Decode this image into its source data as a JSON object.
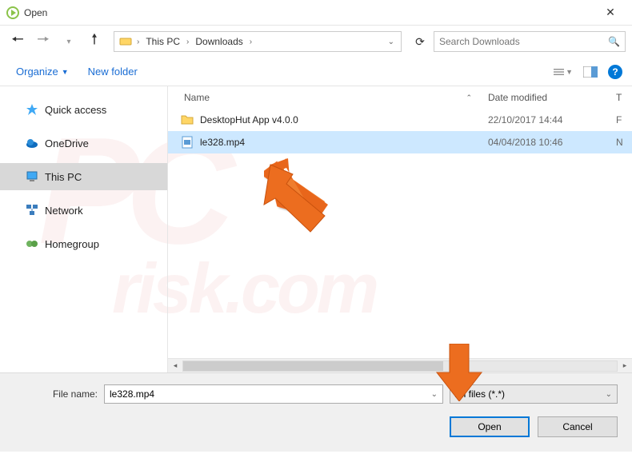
{
  "window": {
    "title": "Open",
    "close": "✕"
  },
  "nav": {
    "path": [
      "This PC",
      "Downloads"
    ],
    "search_placeholder": "Search Downloads"
  },
  "toolbar": {
    "organize": "Organize",
    "new_folder": "New folder",
    "help": "?"
  },
  "sidebar": {
    "items": [
      {
        "label": "Quick access",
        "icon": "star",
        "color": "#3fa9f5"
      },
      {
        "label": "OneDrive",
        "icon": "cloud",
        "color": "#0f6cbd"
      },
      {
        "label": "This PC",
        "icon": "pc",
        "color": "#3fa9f5",
        "selected": true
      },
      {
        "label": "Network",
        "icon": "network",
        "color": "#3b7dbd"
      },
      {
        "label": "Homegroup",
        "icon": "home",
        "color": "#6fb35f"
      }
    ]
  },
  "columns": {
    "name": "Name",
    "date": "Date modified",
    "type": "T"
  },
  "files": [
    {
      "name": "DesktopHut App v4.0.0",
      "date": "22/10/2017 14:44",
      "type": "F",
      "icon": "folder",
      "selected": false
    },
    {
      "name": "le328.mp4",
      "date": "04/04/2018 10:46",
      "type": "N",
      "icon": "file",
      "selected": true
    }
  ],
  "bottom": {
    "filename_label": "File name:",
    "filename_value": "le328.mp4",
    "filter_value": "All files (*.*)",
    "open": "Open",
    "cancel": "Cancel"
  },
  "watermark": {
    "big": "PC",
    "small": "risk.com"
  }
}
